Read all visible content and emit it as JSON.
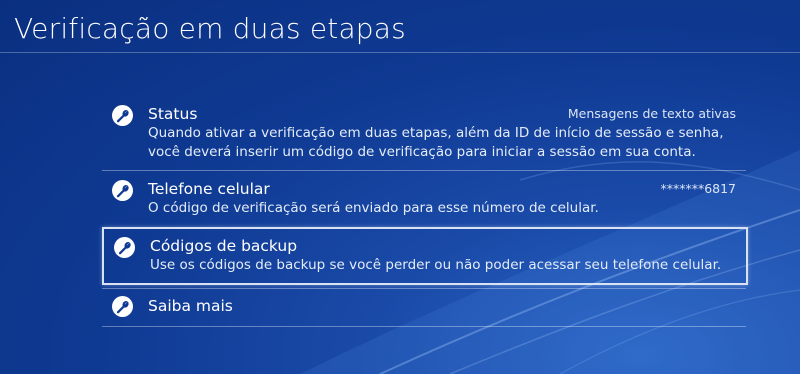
{
  "page": {
    "title": "Verificação em duas etapas"
  },
  "menu": {
    "items": [
      {
        "id": "status",
        "label": "Status",
        "value": "Mensagens de texto ativas",
        "description": "Quando ativar a verificação em duas etapas, além da ID de início de sessão e senha, você deverá inserir um código de verificação para iniciar a sessão em sua conta.",
        "icon": "wrench-icon"
      },
      {
        "id": "phone",
        "label": "Telefone celular",
        "value": "*******6817",
        "description": "O código de verificação será enviado para esse número de celular.",
        "icon": "wrench-icon"
      },
      {
        "id": "backup",
        "label": "Códigos de backup",
        "description": "Use os códigos de backup se você perder ou não poder acessar seu telefone celular.",
        "icon": "wrench-icon",
        "selected": true
      },
      {
        "id": "learn",
        "label": "Saiba mais",
        "icon": "wrench-icon"
      }
    ]
  },
  "colors": {
    "background": "#0f3a93",
    "text": "#ffffff",
    "focus_border": "#d8e2f2"
  }
}
